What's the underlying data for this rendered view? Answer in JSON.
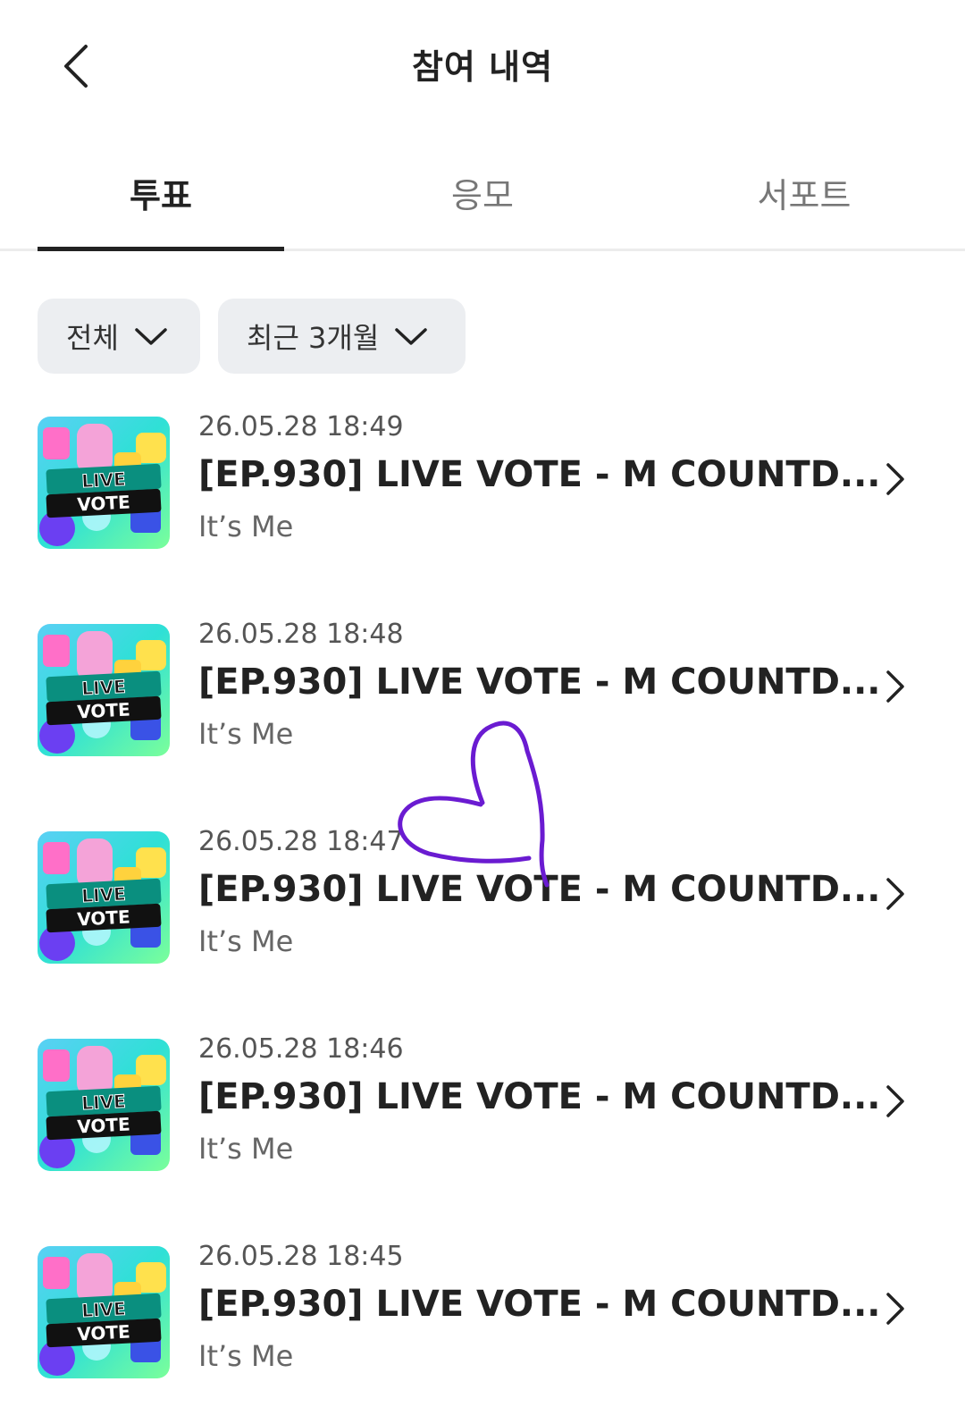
{
  "header": {
    "title": "참여 내역",
    "back_icon": "back-chevron-icon"
  },
  "tabs": [
    {
      "label": "투표",
      "active": true
    },
    {
      "label": "응모",
      "active": false
    },
    {
      "label": "서포트",
      "active": false
    }
  ],
  "filters": [
    {
      "label": "전체",
      "icon": "chevron-down-icon"
    },
    {
      "label": "최근 3개월",
      "icon": "chevron-down-icon"
    }
  ],
  "items": [
    {
      "date": "26.05.28 18:49",
      "title": "[EP.930] LIVE VOTE - M COUNTD...",
      "subtitle": "It’s Me",
      "thumbnail_text": [
        "LIVE",
        "VOTE"
      ]
    },
    {
      "date": "26.05.28 18:48",
      "title": "[EP.930] LIVE VOTE - M COUNTD...",
      "subtitle": "It’s Me",
      "thumbnail_text": [
        "LIVE",
        "VOTE"
      ]
    },
    {
      "date": "26.05.28 18:47",
      "title": "[EP.930] LIVE VOTE - M COUNTD...",
      "subtitle": "It’s Me",
      "thumbnail_text": [
        "LIVE",
        "VOTE"
      ]
    },
    {
      "date": "26.05.28 18:46",
      "title": "[EP.930] LIVE VOTE - M COUNTD...",
      "subtitle": "It’s Me",
      "thumbnail_text": [
        "LIVE",
        "VOTE"
      ]
    },
    {
      "date": "26.05.28 18:45",
      "title": "[EP.930] LIVE VOTE - M COUNTD...",
      "subtitle": "It’s Me",
      "thumbnail_text": [
        "LIVE",
        "VOTE"
      ]
    }
  ],
  "colors": {
    "active_tab": "#222222",
    "chip_bg": "#eceef1",
    "thumbnail_bg": "#2ed0d8",
    "doodle": "#6a1bd1"
  }
}
